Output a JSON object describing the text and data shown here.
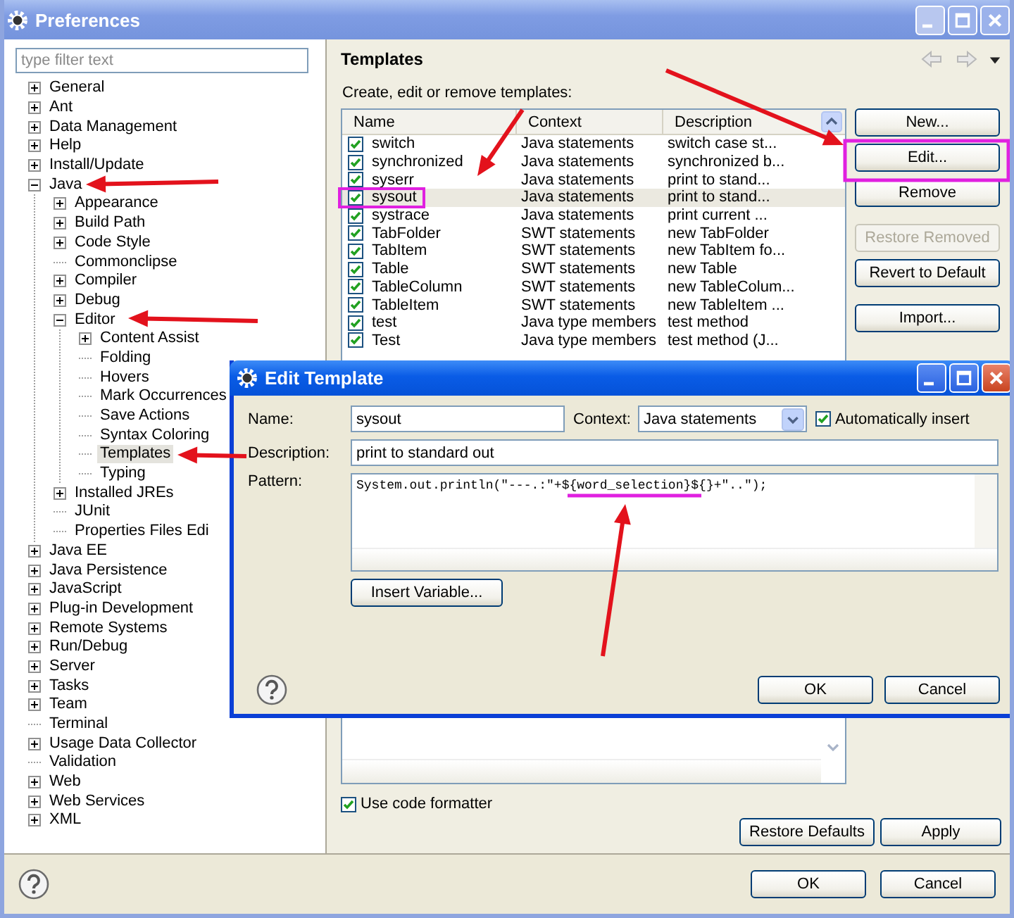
{
  "window": {
    "title": "Preferences"
  },
  "filter": {
    "placeholder": "type filter text"
  },
  "tree": [
    {
      "label": "General",
      "expanded": false,
      "selected": false
    },
    {
      "label": "Ant",
      "expanded": false,
      "selected": false
    },
    {
      "label": "Data Management",
      "expanded": false,
      "selected": false
    },
    {
      "label": "Help",
      "expanded": false,
      "selected": false
    },
    {
      "label": "Install/Update",
      "expanded": false,
      "selected": false
    },
    {
      "label": "Java",
      "expanded": true,
      "selected": false,
      "children": [
        {
          "label": "Appearance",
          "expanded": false,
          "selected": false
        },
        {
          "label": "Build Path",
          "expanded": false,
          "selected": false
        },
        {
          "label": "Code Style",
          "expanded": false,
          "selected": false
        },
        {
          "label": "Commonclipse",
          "selected": false
        },
        {
          "label": "Compiler",
          "expanded": false,
          "selected": false
        },
        {
          "label": "Debug",
          "expanded": false,
          "selected": false
        },
        {
          "label": "Editor",
          "expanded": true,
          "selected": false,
          "children": [
            {
              "label": "Content Assist",
              "expanded": false,
              "selected": false
            },
            {
              "label": "Folding",
              "selected": false
            },
            {
              "label": "Hovers",
              "selected": false
            },
            {
              "label": "Mark Occurrences",
              "selected": false
            },
            {
              "label": "Save Actions",
              "selected": false
            },
            {
              "label": "Syntax Coloring",
              "selected": false
            },
            {
              "label": "Templates",
              "selected": true
            },
            {
              "label": "Typing",
              "selected": false
            }
          ]
        },
        {
          "label": "Installed JREs",
          "expanded": false,
          "selected": false
        },
        {
          "label": "JUnit",
          "selected": false
        },
        {
          "label": "Properties Files Edi",
          "selected": false
        }
      ]
    },
    {
      "label": "Java EE",
      "expanded": false,
      "selected": false
    },
    {
      "label": "Java Persistence",
      "expanded": false,
      "selected": false
    },
    {
      "label": "JavaScript",
      "expanded": false,
      "selected": false
    },
    {
      "label": "Plug-in Development",
      "expanded": false,
      "selected": false
    },
    {
      "label": "Remote Systems",
      "expanded": false,
      "selected": false
    },
    {
      "label": "Run/Debug",
      "expanded": false,
      "selected": false
    },
    {
      "label": "Server",
      "expanded": false,
      "selected": false
    },
    {
      "label": "Tasks",
      "expanded": false,
      "selected": false
    },
    {
      "label": "Team",
      "expanded": false,
      "selected": false
    },
    {
      "label": "Terminal",
      "selected": false
    },
    {
      "label": "Usage Data Collector",
      "expanded": false,
      "selected": false
    },
    {
      "label": "Validation",
      "selected": false
    },
    {
      "label": "Web",
      "expanded": false,
      "selected": false
    },
    {
      "label": "Web Services",
      "expanded": false,
      "selected": false
    },
    {
      "label": "XML",
      "expanded": false,
      "selected": false
    }
  ],
  "page": {
    "title": "Templates",
    "subtitle": "Create, edit or remove templates:"
  },
  "table": {
    "columns": [
      "Name",
      "Context",
      "Description"
    ],
    "rows": [
      {
        "name": "switch",
        "context": "Java statements",
        "description": "switch case st...",
        "checked": true,
        "selected": false
      },
      {
        "name": "synchronized",
        "context": "Java statements",
        "description": "synchronized b...",
        "checked": true,
        "selected": false
      },
      {
        "name": "syserr",
        "context": "Java statements",
        "description": "print to stand...",
        "checked": true,
        "selected": false
      },
      {
        "name": "sysout",
        "context": "Java statements",
        "description": "print to stand...",
        "checked": true,
        "selected": true
      },
      {
        "name": "systrace",
        "context": "Java statements",
        "description": "print current ...",
        "checked": true,
        "selected": false
      },
      {
        "name": "TabFolder",
        "context": "SWT statements",
        "description": "new TabFolder",
        "checked": true,
        "selected": false
      },
      {
        "name": "TabItem",
        "context": "SWT statements",
        "description": "new TabItem fo...",
        "checked": true,
        "selected": false
      },
      {
        "name": "Table",
        "context": "SWT statements",
        "description": "new Table",
        "checked": true,
        "selected": false
      },
      {
        "name": "TableColumn",
        "context": "SWT statements",
        "description": "new TableColum...",
        "checked": true,
        "selected": false
      },
      {
        "name": "TableItem",
        "context": "SWT statements",
        "description": "new TableItem ...",
        "checked": true,
        "selected": false
      },
      {
        "name": "test",
        "context": "Java type members",
        "description": "test method",
        "checked": true,
        "selected": false
      },
      {
        "name": "Test",
        "context": "Java type members",
        "description": "test method (J...",
        "checked": true,
        "selected": false
      }
    ]
  },
  "side_buttons": [
    {
      "label": "New...",
      "disabled": false
    },
    {
      "label": "Edit...",
      "disabled": false
    },
    {
      "label": "Remove",
      "disabled": false
    },
    {
      "label": "Restore Removed",
      "disabled": true
    },
    {
      "label": "Revert to Default",
      "disabled": false
    },
    {
      "label": "Import...",
      "disabled": false
    }
  ],
  "code_formatter": {
    "label": "Use code formatter",
    "checked": true
  },
  "page_buttons": [
    "Restore Defaults",
    "Apply"
  ],
  "dialog_buttons": [
    "OK",
    "Cancel"
  ],
  "edit_template": {
    "title": "Edit Template",
    "name_label": "Name:",
    "name": "sysout",
    "context_label": "Context:",
    "context": "Java statements",
    "auto_insert": {
      "label": "Automatically insert",
      "checked": true
    },
    "description_label": "Description:",
    "description": "print to standard out",
    "pattern_label": "Pattern:",
    "pattern": "System.out.println(\"---.:\"+${word_selection}${}+\"..\");",
    "insert_variable": "Insert Variable...",
    "buttons": [
      "OK",
      "Cancel"
    ]
  }
}
